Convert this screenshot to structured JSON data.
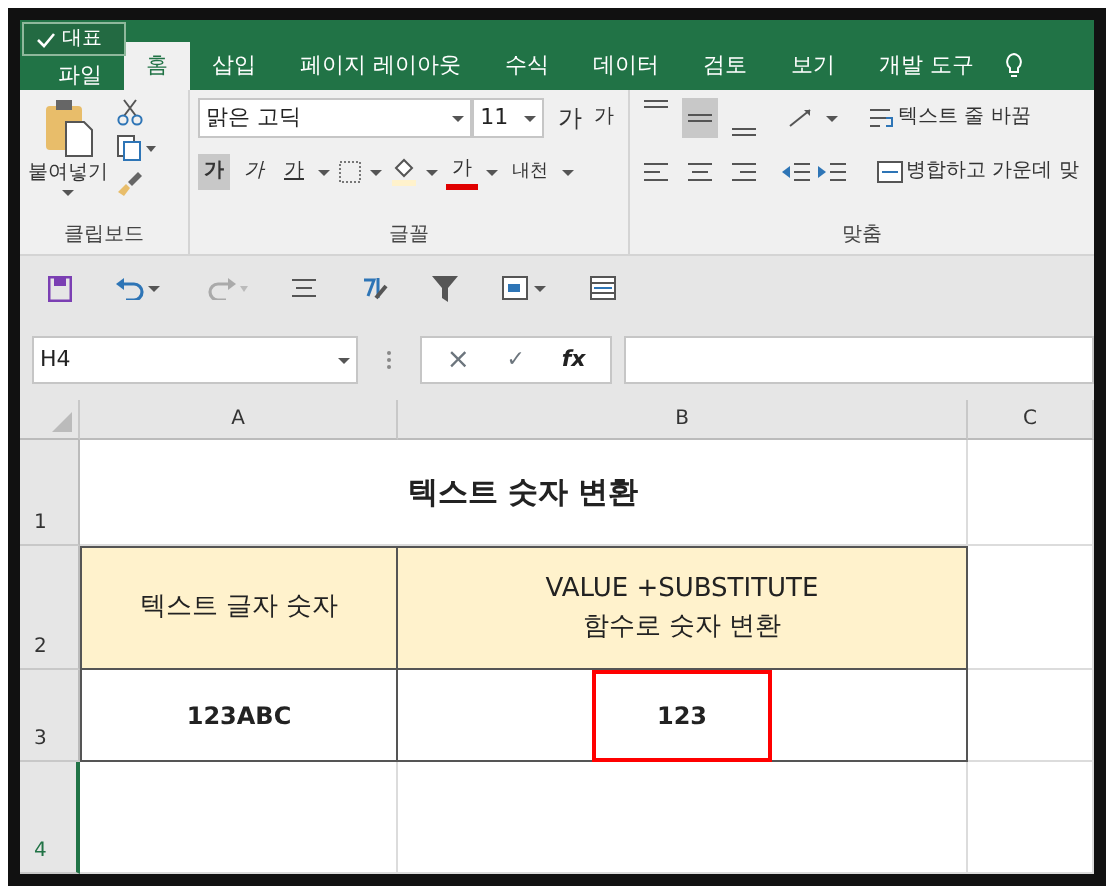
{
  "tabs": [
    {
      "label": "파일",
      "selected": false
    },
    {
      "label": "홈",
      "selected": true
    },
    {
      "label": "삽입",
      "selected": false
    },
    {
      "label": "페이지 레이아웃",
      "selected": false
    },
    {
      "label": "수식",
      "selected": false
    },
    {
      "label": "데이터",
      "selected": false
    },
    {
      "label": "검토",
      "selected": false
    },
    {
      "label": "보기",
      "selected": false
    },
    {
      "label": "개발 도구",
      "selected": false
    }
  ],
  "overlay_tag": {
    "label": "대표"
  },
  "clipboard": {
    "paste_label": "붙여넣기",
    "group_label": "클립보드"
  },
  "font": {
    "font_name": "맑은 고딕",
    "font_size": "11",
    "grow_label": "가",
    "shrink_label": "가",
    "group_label": "글꼴",
    "styles": [
      {
        "kind": "bold",
        "label": "가",
        "selected": true
      },
      {
        "kind": "italic",
        "label": "가",
        "selected": false
      },
      {
        "kind": "underline",
        "label": "가",
        "selected": false
      }
    ],
    "font_color_label": "가",
    "phonetic_label": "내천"
  },
  "alignment": {
    "group_label": "맞춤",
    "vertical": [
      {
        "selected": false
      },
      {
        "selected": true
      },
      {
        "selected": false
      }
    ],
    "wrap_label": "텍스트 줄 바꿈",
    "merge_label": "병합하고 가운데 맞"
  },
  "formula_bar": {
    "name_box": "H4",
    "cancel": "×",
    "enter": "✓",
    "fx": "fx"
  },
  "sheet": {
    "columns": [
      "A",
      "B",
      "C"
    ],
    "rows": [
      {
        "label": "1",
        "selected": false
      },
      {
        "label": "2",
        "selected": false
      },
      {
        "label": "3",
        "selected": false
      },
      {
        "label": "4",
        "selected": true
      }
    ],
    "title": "텍스트 숫자 변환",
    "headers": [
      {
        "lines": [
          "텍스트 글자 숫자"
        ]
      },
      {
        "lines": [
          "VALUE +SUBSTITUTE",
          "함수로 숫자 변환"
        ]
      }
    ],
    "values": [
      {
        "text": "123ABC",
        "highlighted": false
      },
      {
        "text": "123",
        "highlighted": true
      }
    ]
  }
}
